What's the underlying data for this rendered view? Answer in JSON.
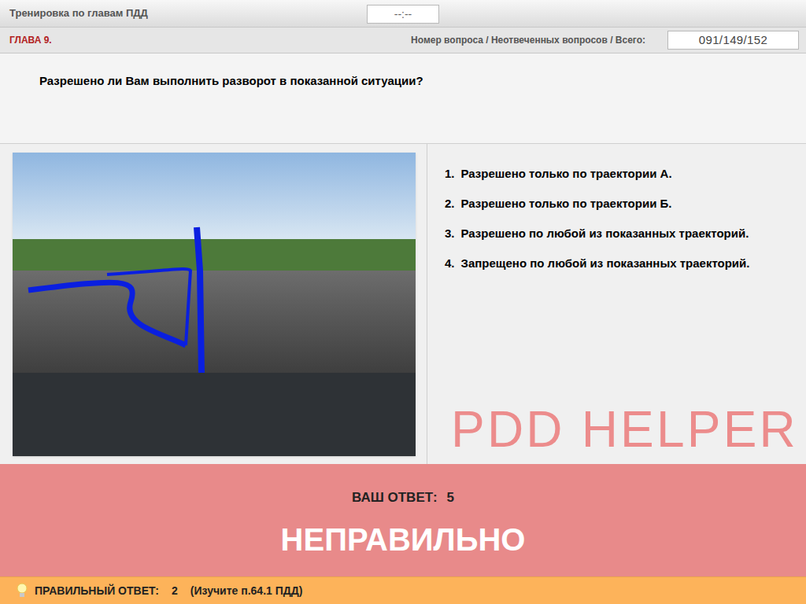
{
  "top_bar": {
    "title": "Тренировка по главам ПДД",
    "timer": "--:--"
  },
  "info_bar": {
    "chapter": "ГЛАВА 9.",
    "counter_label": "Номер вопроса / Неотвеченных вопросов / Всего:",
    "counter": "091/149/152"
  },
  "question": "Разрешено ли Вам выполнить разворот в показанной ситуации?",
  "answers": [
    {
      "number": "1.",
      "text": "Разрешено только по траектории А."
    },
    {
      "number": "2.",
      "text": "Разрешено только по траектории Б."
    },
    {
      "number": "3.",
      "text": "Разрешено по любой из показанных траекторий."
    },
    {
      "number": "4.",
      "text": "Запрещено по любой из показанных траекторий."
    }
  ],
  "watermark": "PDD HELPER",
  "result": {
    "your_answer_label": "ВАШ  ОТВЕТ:",
    "your_answer": "5",
    "verdict": "НЕПРАВИЛЬНО"
  },
  "correct": {
    "label": "ПРАВИЛЬНЫЙ ОТВЕТ:",
    "value": "2",
    "hint": "(Изучите п.64.1 ПДД)"
  }
}
